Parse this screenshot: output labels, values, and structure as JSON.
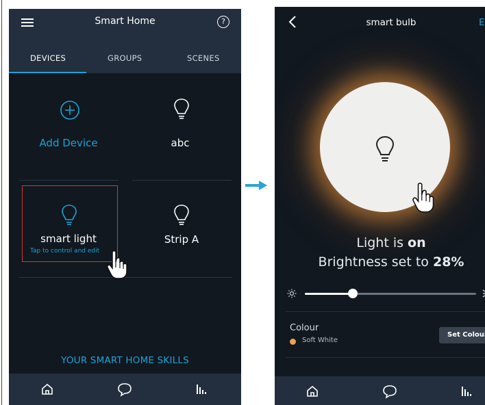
{
  "left": {
    "header": {
      "title": "Smart Home",
      "menu_icon": "hamburger-menu-icon",
      "help_icon": "help-icon",
      "help_glyph": "?"
    },
    "tabs": [
      {
        "label": "DEVICES",
        "selected": true
      },
      {
        "label": "GROUPS",
        "selected": false
      },
      {
        "label": "SCENES",
        "selected": false
      }
    ],
    "devices": [
      {
        "label": "Add Device",
        "icon": "add-circle-icon"
      },
      {
        "label": "abc",
        "icon": "bulb-icon"
      },
      {
        "label": "smart light",
        "icon": "bulb-icon",
        "hint": "Tap to control and edit"
      },
      {
        "label": "Strip A",
        "icon": "bulb-icon"
      }
    ],
    "skills_link": "YOUR SMART HOME SKILLS",
    "nav": [
      {
        "icon": "home-icon"
      },
      {
        "icon": "chat-icon"
      },
      {
        "icon": "equalizer-icon"
      }
    ]
  },
  "right": {
    "header": {
      "title": "smart bulb",
      "edit": "E",
      "back_icon": "back-chevron-icon"
    },
    "state_prefix": "Light is ",
    "state_value": "on",
    "brightness_prefix": "Brightness set to ",
    "brightness_value": "28%",
    "brightness_level": 0.28,
    "colour": {
      "title": "Colour",
      "value": "Soft White",
      "dot_color": "#f0a050",
      "button": "Set Colour"
    },
    "nav": [
      {
        "icon": "home-icon"
      },
      {
        "icon": "chat-icon"
      },
      {
        "icon": "equalizer-icon"
      }
    ]
  },
  "colors": {
    "accent": "#1ca3d6",
    "header_bg": "#232f3e",
    "body_bg": "#111820",
    "selection": "#d23b2f",
    "arrow": "#2ba4d8"
  }
}
